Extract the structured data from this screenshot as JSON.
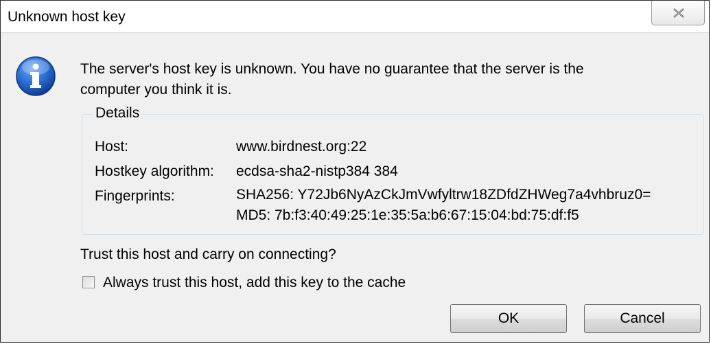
{
  "window": {
    "title": "Unknown host key",
    "close_icon": "close-icon"
  },
  "message": {
    "icon": "info-icon",
    "text": "The server's host key is unknown. You have no guarantee that the server is the computer you think it is."
  },
  "details": {
    "legend": "Details",
    "host_label": "Host:",
    "host_value": "www.birdnest.org:22",
    "algorithm_label": "Hostkey algorithm:",
    "algorithm_value": "ecdsa-sha2-nistp384 384",
    "fingerprints_label": "Fingerprints:",
    "fingerprint_sha256": "SHA256: Y72Jb6NyAzCkJmVwfyltrw18ZDfdZHWeg7a4vhbruz0=",
    "fingerprint_md5": "MD5: 7b:f3:40:49:25:1e:35:5a:b6:67:15:04:bd:75:df:f5"
  },
  "prompt": {
    "question": "Trust this host and carry on connecting?",
    "checkbox_label": "Always trust this host, add this key to the cache",
    "checkbox_checked": false
  },
  "buttons": {
    "ok_label": "OK",
    "cancel_label": "Cancel"
  },
  "colors": {
    "icon_blue": "#1f5fc2",
    "client_bg": "#f0f0f0",
    "details_border": "#d5dfe5"
  }
}
